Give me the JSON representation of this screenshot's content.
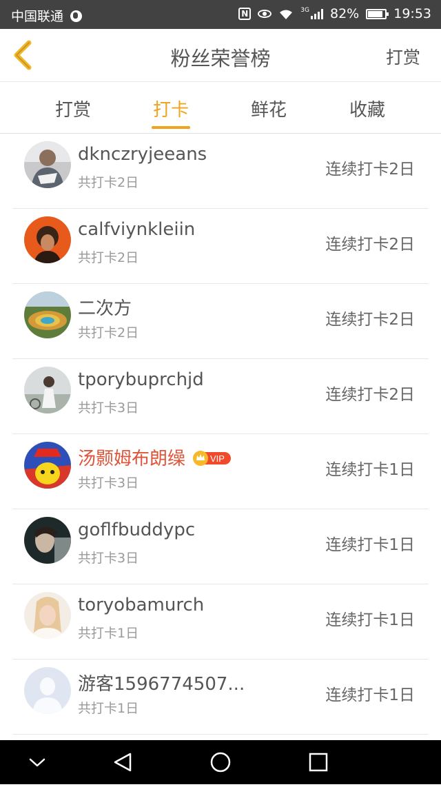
{
  "status_bar": {
    "carrier": "中国联通",
    "network": "3G",
    "battery": "82%",
    "time": "19:53"
  },
  "header": {
    "title": "粉丝荣誉榜",
    "action_label": "打赏"
  },
  "tabs": [
    {
      "label": "打赏",
      "active": false
    },
    {
      "label": "打卡",
      "active": true
    },
    {
      "label": "鲜花",
      "active": false
    },
    {
      "label": "收藏",
      "active": false
    }
  ],
  "rows": [
    {
      "name": "dknczryjeeans",
      "total": "共打卡2日",
      "streak": "连续打卡2日",
      "vip": false
    },
    {
      "name": "calfviynkleiin",
      "total": "共打卡2日",
      "streak": "连续打卡2日",
      "vip": false
    },
    {
      "name": "二次方",
      "total": "共打卡2日",
      "streak": "连续打卡2日",
      "vip": false
    },
    {
      "name": "tporybuprchjd",
      "total": "共打卡3日",
      "streak": "连续打卡2日",
      "vip": false
    },
    {
      "name": "汤颢姆布朗缲",
      "total": "共打卡3日",
      "streak": "连续打卡1日",
      "vip": true,
      "vip_label": "VIP"
    },
    {
      "name": "goflfbuddypc",
      "total": "共打卡3日",
      "streak": "连续打卡1日",
      "vip": false
    },
    {
      "name": "toryobamurch",
      "total": "共打卡1日",
      "streak": "连续打卡1日",
      "vip": false
    },
    {
      "name": "游客1596774507...",
      "total": "共打卡1日",
      "streak": "连续打卡1日",
      "vip": false
    }
  ],
  "colors": {
    "accent": "#f0a31c",
    "vip_name": "#e0553a",
    "status_bar": "#424242",
    "nav_bar": "#000000"
  },
  "icons": {
    "back": "chevron-left-icon",
    "vip": "crown-icon",
    "nav_back": "triangle-back-icon",
    "nav_home": "circle-home-icon",
    "nav_recents": "square-recents-icon"
  }
}
